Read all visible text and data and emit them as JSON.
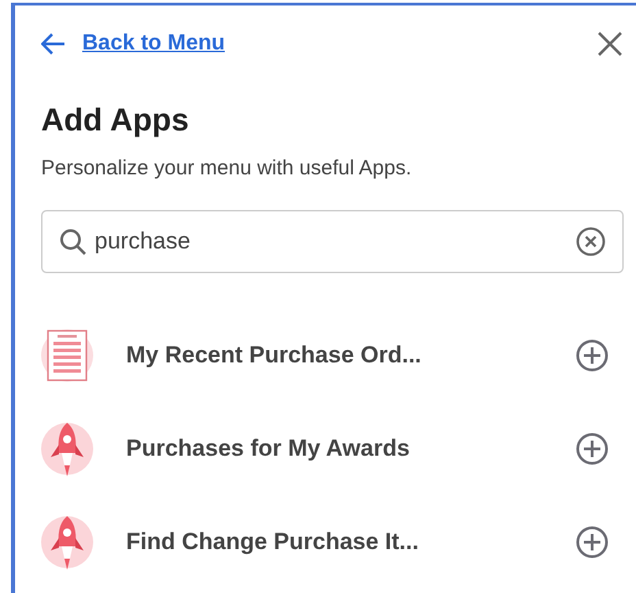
{
  "header": {
    "back_link": "Back to Menu"
  },
  "title": "Add Apps",
  "subtitle": "Personalize your menu with useful Apps.",
  "search": {
    "value": "purchase"
  },
  "apps": [
    {
      "name": "My Recent Purchase Ord...",
      "kind": "document"
    },
    {
      "name": "Purchases for My Awards",
      "kind": "rocket"
    },
    {
      "name": "Find Change Purchase It...",
      "kind": "rocket"
    }
  ]
}
